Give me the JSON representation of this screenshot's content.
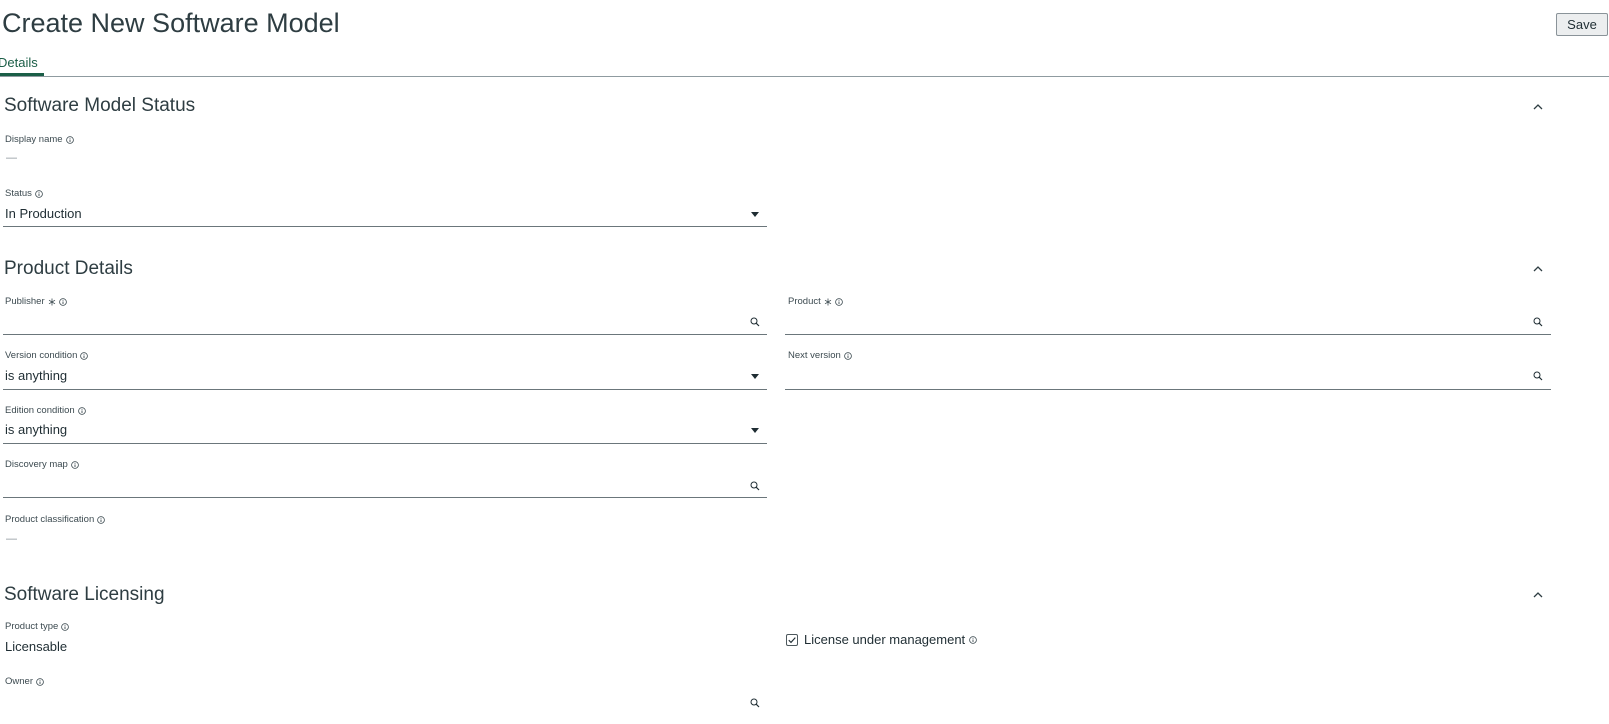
{
  "header": {
    "title": "Create New Software Model",
    "save_label": "Save"
  },
  "tabs": [
    {
      "label": "Details",
      "active": true
    }
  ],
  "sections": {
    "status": {
      "title": "Software Model Status",
      "display_name_label": "Display name",
      "display_name_value": "—",
      "status_label": "Status",
      "status_value": "In Production"
    },
    "product": {
      "title": "Product Details",
      "publisher_label": "Publisher",
      "publisher_value": "",
      "product_label": "Product",
      "product_value": "",
      "version_condition_label": "Version condition",
      "version_condition_value": "is anything",
      "next_version_label": "Next version",
      "next_version_value": "",
      "edition_condition_label": "Edition condition",
      "edition_condition_value": "is anything",
      "discovery_map_label": "Discovery map",
      "discovery_map_value": "",
      "product_classification_label": "Product classification",
      "product_classification_value": "—"
    },
    "licensing": {
      "title": "Software Licensing",
      "product_type_label": "Product type",
      "product_type_value": "Licensable",
      "license_under_management_label": "License under management",
      "license_under_management_checked": true,
      "owner_label": "Owner",
      "owner_value": ""
    }
  },
  "icons": {
    "info": "info-circle-icon",
    "required": "asterisk-icon",
    "search": "search-icon",
    "chevron": "chevron-up-icon",
    "dropdown": "caret-down-icon",
    "checkbox": "checkmark-icon"
  },
  "colors": {
    "accent": "#1b5e47",
    "text": "#1f2d33",
    "title": "#2e3d42",
    "border": "#6b767b"
  }
}
